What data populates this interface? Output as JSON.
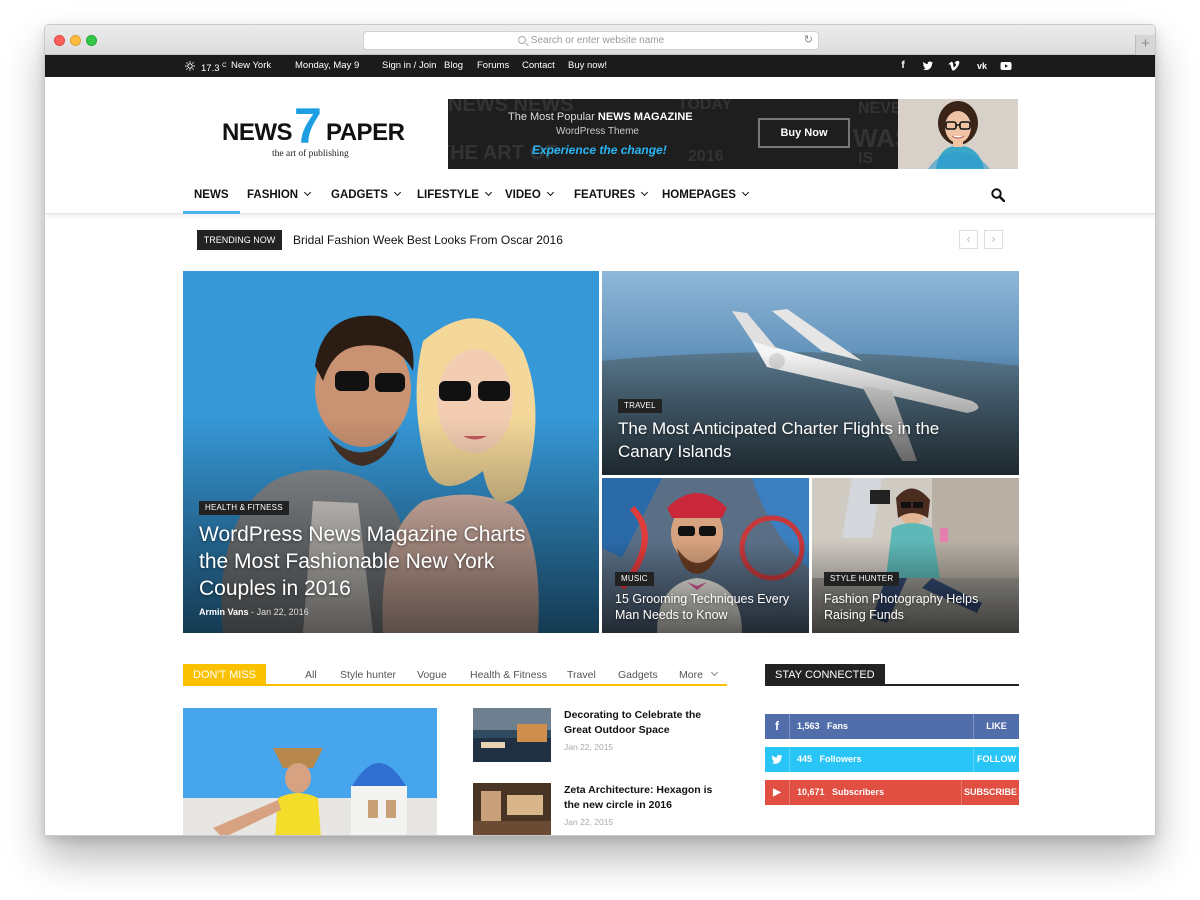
{
  "browser": {
    "url_placeholder": "Search or enter website name",
    "reload_icon": "reload-icon",
    "new_tab": "+"
  },
  "topbar": {
    "weather_temp": "17.3",
    "weather_unit": "C",
    "weather_city": "New York",
    "date": "Monday, May 9",
    "links": [
      "Sign in / Join",
      "Blog",
      "Forums",
      "Contact",
      "Buy now!"
    ],
    "social": [
      {
        "icon": "facebook-icon",
        "glyph": "f"
      },
      {
        "icon": "twitter-icon",
        "glyph": "t"
      },
      {
        "icon": "vimeo-icon",
        "glyph": "v"
      },
      {
        "icon": "vk-icon",
        "glyph": "vk"
      },
      {
        "icon": "youtube-icon",
        "glyph": "▶"
      }
    ]
  },
  "logo": {
    "word1": "NEWS",
    "number": "7",
    "word2": "PAPER",
    "tagline": "the art of publishing"
  },
  "banner": {
    "line1_prefix": "The Most Popular ",
    "line1_bold": "NEWS MAGAZINE",
    "line2": "WordPress Theme",
    "line3": "Experience the change!",
    "button": "Buy Now"
  },
  "nav": {
    "items": [
      {
        "label": "NEWS",
        "dropdown": false
      },
      {
        "label": "FASHION",
        "dropdown": true
      },
      {
        "label": "GADGETS",
        "dropdown": true
      },
      {
        "label": "LIFESTYLE",
        "dropdown": true
      },
      {
        "label": "VIDEO",
        "dropdown": true
      },
      {
        "label": "FEATURES",
        "dropdown": true
      },
      {
        "label": "HOMEPAGES",
        "dropdown": true
      }
    ]
  },
  "trending": {
    "label": "TRENDING NOW",
    "title": "Bridal Fashion Week Best Looks From Oscar 2016",
    "prev": "‹",
    "next": "›"
  },
  "featured": [
    {
      "category": "HEALTH & FITNESS",
      "title": "WordPress News Magazine Charts the Most Fashionable New York Couples in 2016",
      "author": "Armin Vans",
      "separator": "-",
      "date": "Jan 22, 2016"
    },
    {
      "category": "TRAVEL",
      "title": "The Most Anticipated Charter Flights in the Canary Islands"
    },
    {
      "category": "MUSIC",
      "title": "15 Grooming Techniques Every Man Needs to Know"
    },
    {
      "category": "STYLE HUNTER",
      "title": "Fashion Photography Helps Raising Funds"
    }
  ],
  "dont_miss": {
    "label": "DON'T MISS",
    "tabs": [
      "All",
      "Style hunter",
      "Vogue",
      "Health & Fitness",
      "Travel",
      "Gadgets",
      "More"
    ],
    "articles": [
      {
        "title": "Decorating to Celebrate the Great Outdoor Space",
        "date": "Jan 22, 2015"
      },
      {
        "title": "Zeta Architecture: Hexagon is the new circle in 2016",
        "date": "Jan 22, 2015"
      }
    ]
  },
  "stay_connected": {
    "label": "STAY CONNECTED",
    "rows": [
      {
        "icon": "facebook-icon",
        "glyph": "f",
        "count": "1,563",
        "unit": "Fans",
        "action": "LIKE",
        "color": "#516eab"
      },
      {
        "icon": "twitter-icon",
        "glyph": "t",
        "count": "445",
        "unit": "Followers",
        "action": "FOLLOW",
        "color": "#29c5f6"
      },
      {
        "icon": "youtube-icon",
        "glyph": "▶",
        "count": "10,671",
        "unit": "Subscribers",
        "action": "SUBSCRIBE",
        "color": "#e14e42"
      }
    ]
  },
  "colors": {
    "accent": "#4db2ec",
    "logo_blue": "#1e9fe3",
    "dont_miss": "#f9c100",
    "topbar": "#1b1b1b"
  }
}
